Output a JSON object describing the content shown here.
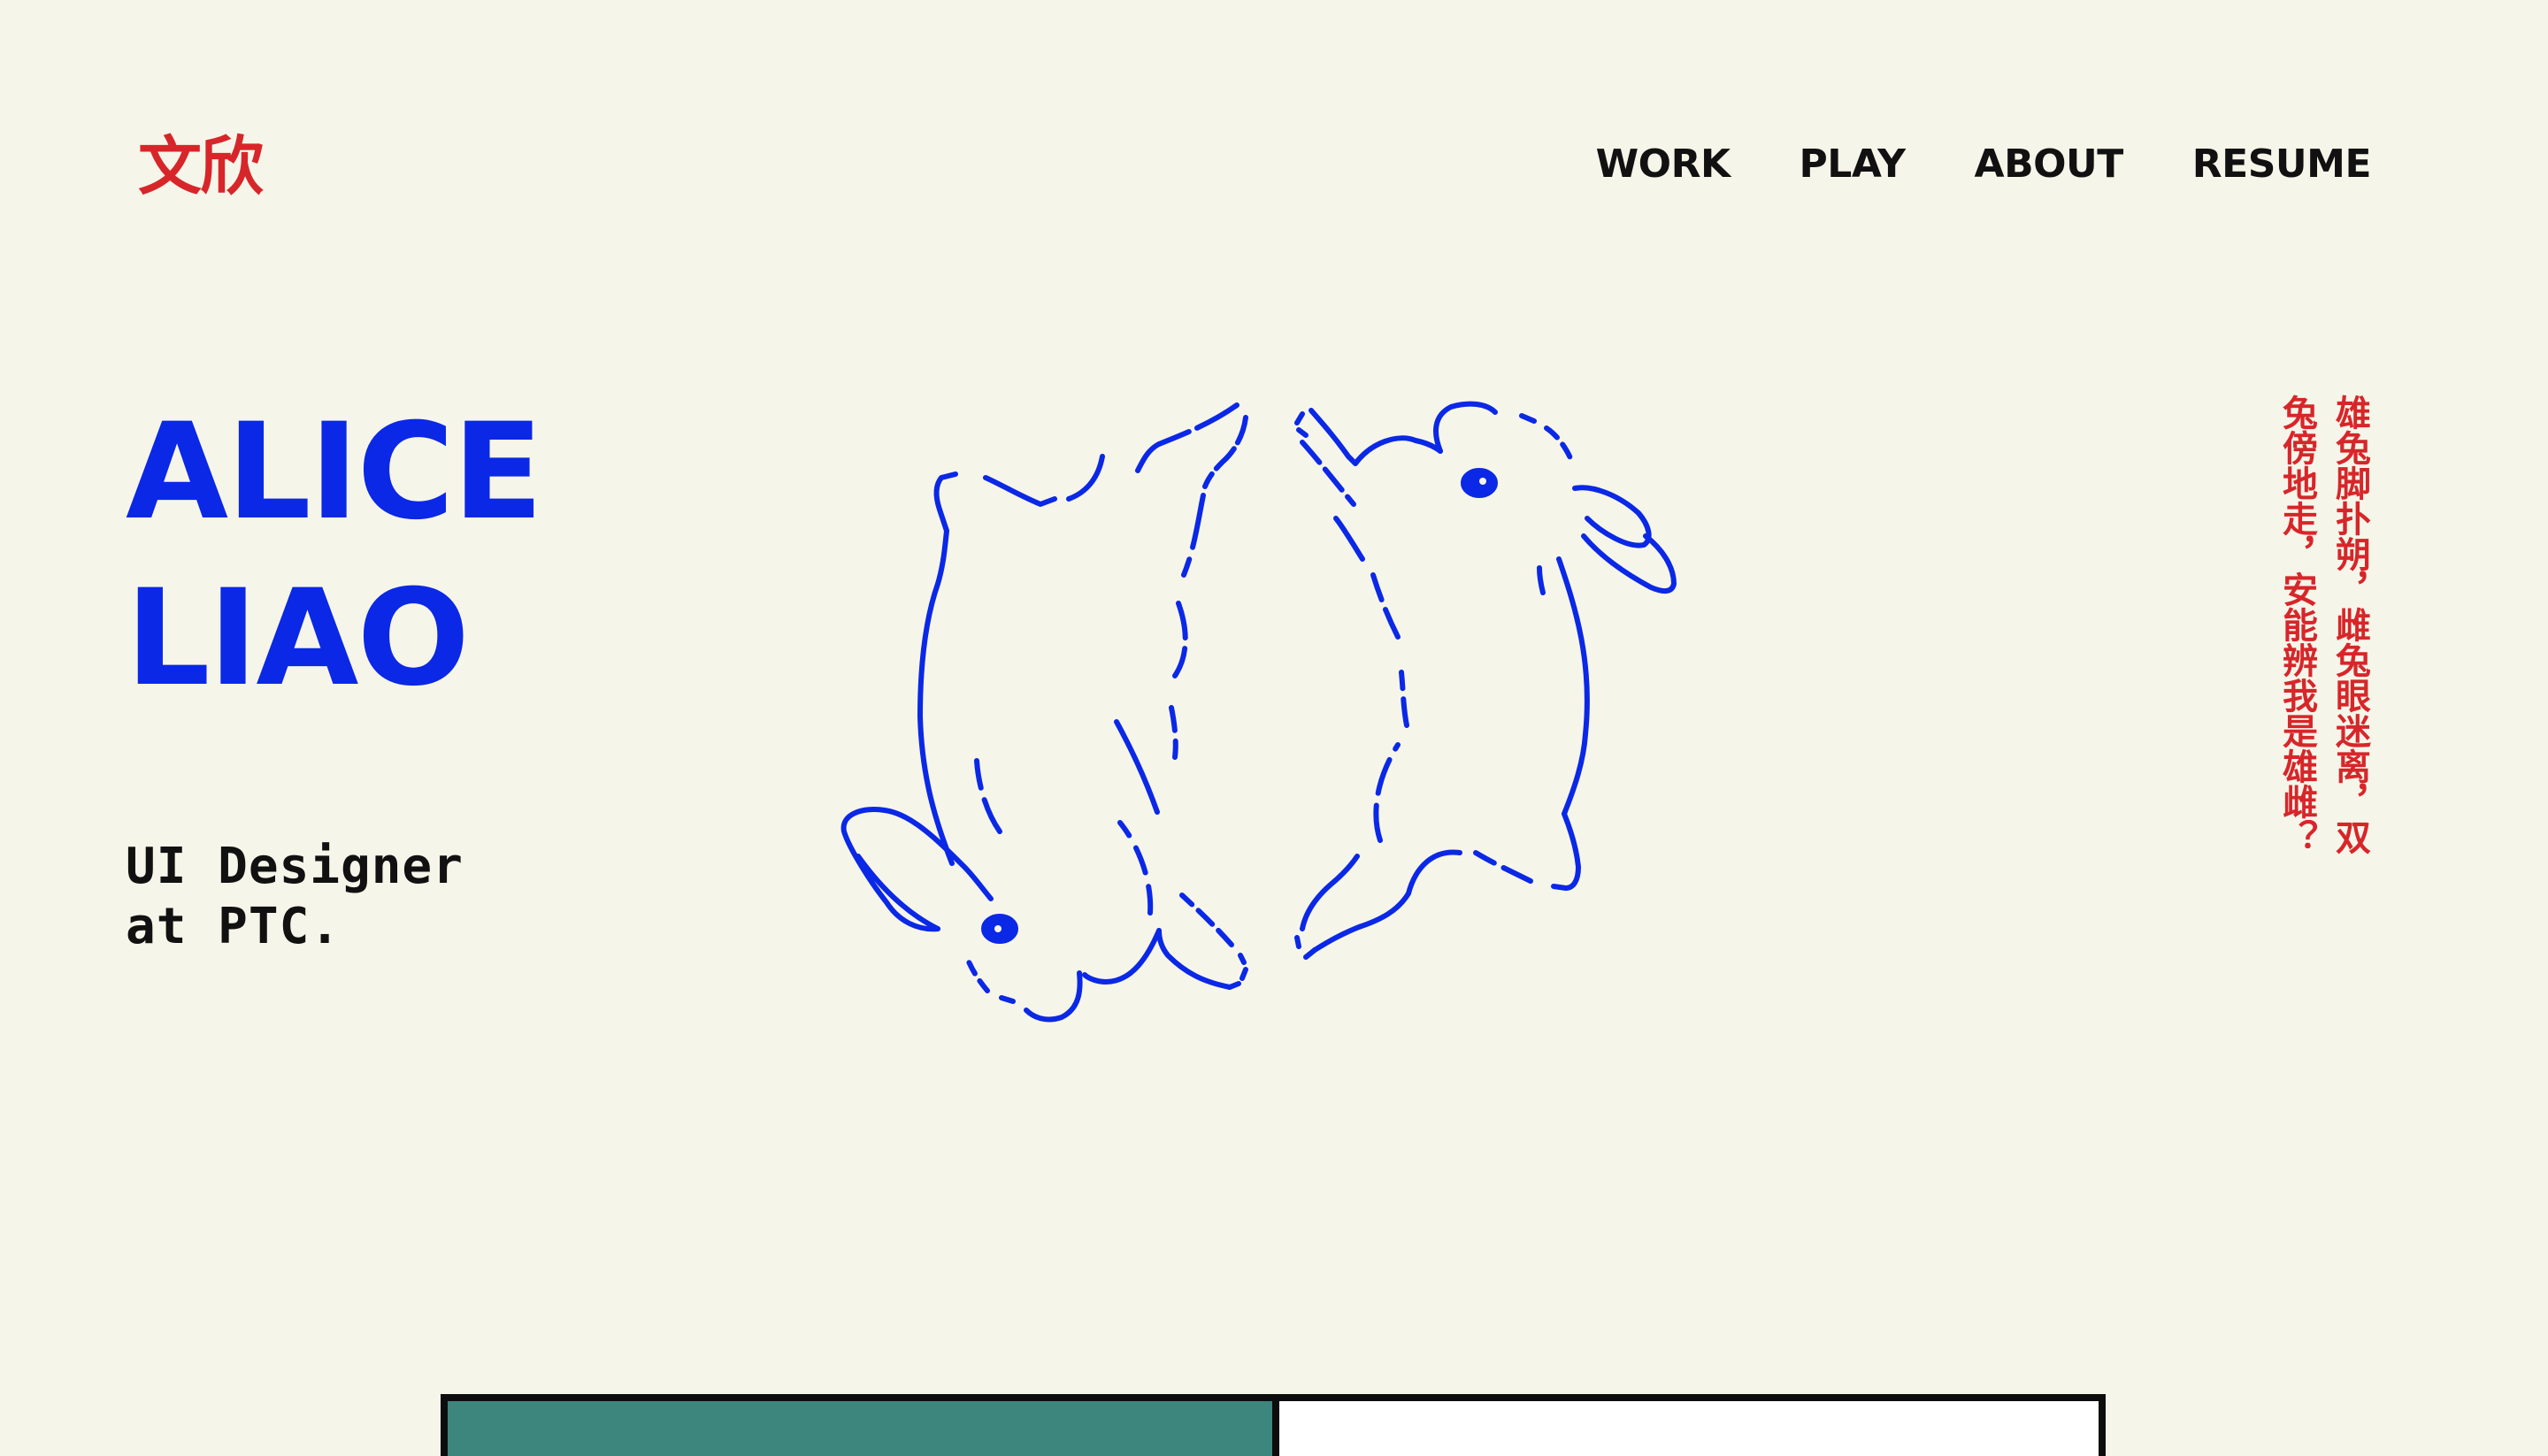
{
  "logo": {
    "text": "文欣"
  },
  "nav": {
    "items": [
      {
        "label": "WORK"
      },
      {
        "label": "PLAY"
      },
      {
        "label": "ABOUT"
      },
      {
        "label": "RESUME"
      }
    ]
  },
  "hero": {
    "first_name": "ALICE",
    "last_name": "LIAO",
    "subtitle_line1": "UI Designer",
    "subtitle_line2": "at PTC."
  },
  "poem": {
    "column_right": "雄兔脚扑朔，雌兔眼迷离，双",
    "column_left": "兔傍地走，安能辨我是雄雌？"
  },
  "illustration": {
    "icon": "two-rabbits-line-art",
    "color": "#0a28e6"
  },
  "colors": {
    "background": "#f6f5e9",
    "accent_blue": "#0a28e6",
    "accent_red": "#d7262a",
    "card_teal": "#3d867e",
    "text": "#111111"
  }
}
